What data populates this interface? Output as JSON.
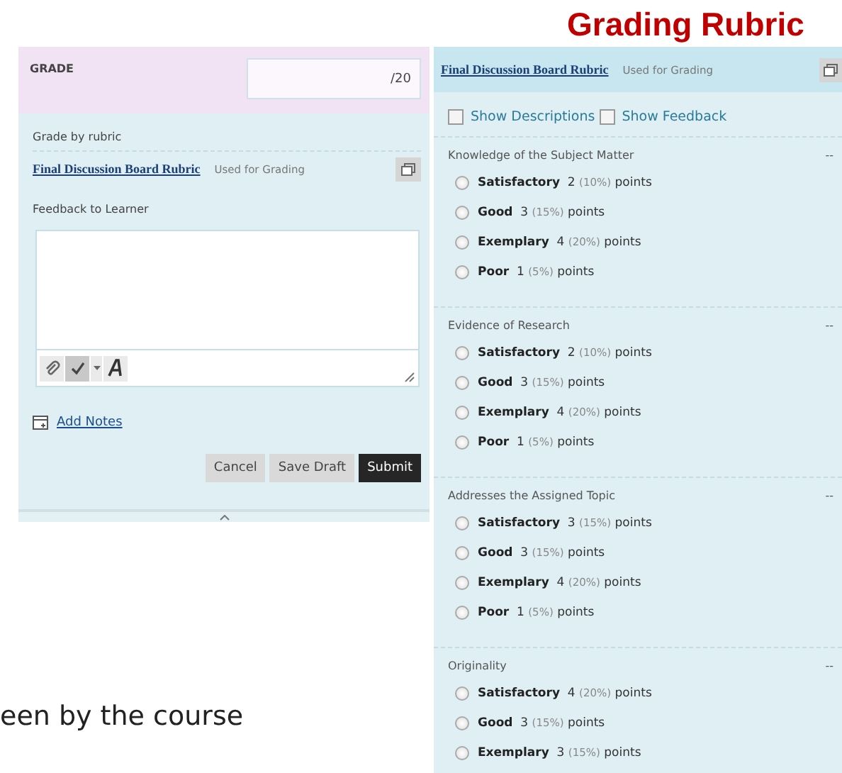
{
  "title": "Grading Rubric",
  "grade_panel": {
    "grade_label": "GRADE",
    "grade_field": {
      "value": "/20"
    },
    "grade_by_rubric": "Grade by rubric",
    "rubric_link": "Final Discussion Board Rubric",
    "rubric_status": "Used for Grading",
    "feedback_label": "Feedback to Learner",
    "add_notes": "Add Notes",
    "buttons": [
      {
        "label": "Cancel",
        "kind": "secondary"
      },
      {
        "label": "Save Draft",
        "kind": "secondary"
      },
      {
        "label": "Submit",
        "kind": "primary"
      }
    ]
  },
  "rubric_panel": {
    "rubric_link": "Final Discussion Board Rubric",
    "rubric_status": "Used for Grading",
    "toggles": [
      {
        "label": "Show Descriptions",
        "checked": false
      },
      {
        "label": "Show Feedback",
        "checked": false
      }
    ],
    "criteria": [
      {
        "name": "Knowledge of the Subject Matter",
        "collapse": "--",
        "options": [
          {
            "level": "Satisfactory",
            "points": "2",
            "percent": "(10%)",
            "unit": "points",
            "selected": false
          },
          {
            "level": "Good",
            "points": "3",
            "percent": "(15%)",
            "unit": "points",
            "selected": false
          },
          {
            "level": "Exemplary",
            "points": "4",
            "percent": "(20%)",
            "unit": "points",
            "selected": false
          },
          {
            "level": "Poor",
            "points": "1",
            "percent": "(5%)",
            "unit": "points",
            "selected": false
          }
        ]
      },
      {
        "name": "Evidence of Research",
        "collapse": "--",
        "options": [
          {
            "level": "Satisfactory",
            "points": "2",
            "percent": "(10%)",
            "unit": "points",
            "selected": false
          },
          {
            "level": "Good",
            "points": "3",
            "percent": "(15%)",
            "unit": "points",
            "selected": false
          },
          {
            "level": "Exemplary",
            "points": "4",
            "percent": "(20%)",
            "unit": "points",
            "selected": false
          },
          {
            "level": "Poor",
            "points": "1",
            "percent": "(5%)",
            "unit": "points",
            "selected": false
          }
        ]
      },
      {
        "name": "Addresses the Assigned Topic",
        "collapse": "--",
        "options": [
          {
            "level": "Satisfactory",
            "points": "3",
            "percent": "(15%)",
            "unit": "points",
            "selected": false
          },
          {
            "level": "Good",
            "points": "3",
            "percent": "(15%)",
            "unit": "points",
            "selected": false
          },
          {
            "level": "Exemplary",
            "points": "4",
            "percent": "(20%)",
            "unit": "points",
            "selected": false
          },
          {
            "level": "Poor",
            "points": "1",
            "percent": "(5%)",
            "unit": "points",
            "selected": false
          }
        ]
      },
      {
        "name": "Originality",
        "collapse": "--",
        "options": [
          {
            "level": "Satisfactory",
            "points": "4",
            "percent": "(20%)",
            "unit": "points",
            "selected": false
          },
          {
            "level": "Good",
            "points": "3",
            "percent": "(15%)",
            "unit": "points",
            "selected": false
          },
          {
            "level": "Exemplary",
            "points": "3",
            "percent": "(15%)",
            "unit": "points",
            "selected": false
          }
        ]
      }
    ]
  },
  "caption": "een by the course"
}
